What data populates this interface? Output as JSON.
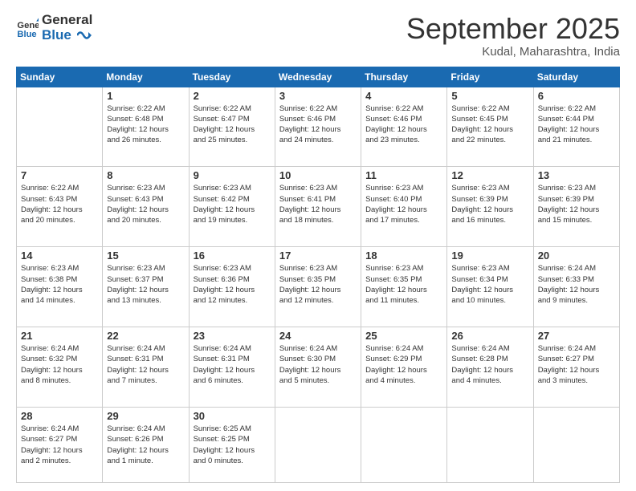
{
  "logo": {
    "line1": "General",
    "line2": "Blue"
  },
  "header": {
    "month": "September 2025",
    "location": "Kudal, Maharashtra, India"
  },
  "days_of_week": [
    "Sunday",
    "Monday",
    "Tuesday",
    "Wednesday",
    "Thursday",
    "Friday",
    "Saturday"
  ],
  "weeks": [
    [
      {
        "num": "",
        "info": ""
      },
      {
        "num": "1",
        "info": "Sunrise: 6:22 AM\nSunset: 6:48 PM\nDaylight: 12 hours\nand 26 minutes."
      },
      {
        "num": "2",
        "info": "Sunrise: 6:22 AM\nSunset: 6:47 PM\nDaylight: 12 hours\nand 25 minutes."
      },
      {
        "num": "3",
        "info": "Sunrise: 6:22 AM\nSunset: 6:46 PM\nDaylight: 12 hours\nand 24 minutes."
      },
      {
        "num": "4",
        "info": "Sunrise: 6:22 AM\nSunset: 6:46 PM\nDaylight: 12 hours\nand 23 minutes."
      },
      {
        "num": "5",
        "info": "Sunrise: 6:22 AM\nSunset: 6:45 PM\nDaylight: 12 hours\nand 22 minutes."
      },
      {
        "num": "6",
        "info": "Sunrise: 6:22 AM\nSunset: 6:44 PM\nDaylight: 12 hours\nand 21 minutes."
      }
    ],
    [
      {
        "num": "7",
        "info": "Sunrise: 6:22 AM\nSunset: 6:43 PM\nDaylight: 12 hours\nand 20 minutes."
      },
      {
        "num": "8",
        "info": "Sunrise: 6:23 AM\nSunset: 6:43 PM\nDaylight: 12 hours\nand 20 minutes."
      },
      {
        "num": "9",
        "info": "Sunrise: 6:23 AM\nSunset: 6:42 PM\nDaylight: 12 hours\nand 19 minutes."
      },
      {
        "num": "10",
        "info": "Sunrise: 6:23 AM\nSunset: 6:41 PM\nDaylight: 12 hours\nand 18 minutes."
      },
      {
        "num": "11",
        "info": "Sunrise: 6:23 AM\nSunset: 6:40 PM\nDaylight: 12 hours\nand 17 minutes."
      },
      {
        "num": "12",
        "info": "Sunrise: 6:23 AM\nSunset: 6:39 PM\nDaylight: 12 hours\nand 16 minutes."
      },
      {
        "num": "13",
        "info": "Sunrise: 6:23 AM\nSunset: 6:39 PM\nDaylight: 12 hours\nand 15 minutes."
      }
    ],
    [
      {
        "num": "14",
        "info": "Sunrise: 6:23 AM\nSunset: 6:38 PM\nDaylight: 12 hours\nand 14 minutes."
      },
      {
        "num": "15",
        "info": "Sunrise: 6:23 AM\nSunset: 6:37 PM\nDaylight: 12 hours\nand 13 minutes."
      },
      {
        "num": "16",
        "info": "Sunrise: 6:23 AM\nSunset: 6:36 PM\nDaylight: 12 hours\nand 12 minutes."
      },
      {
        "num": "17",
        "info": "Sunrise: 6:23 AM\nSunset: 6:35 PM\nDaylight: 12 hours\nand 12 minutes."
      },
      {
        "num": "18",
        "info": "Sunrise: 6:23 AM\nSunset: 6:35 PM\nDaylight: 12 hours\nand 11 minutes."
      },
      {
        "num": "19",
        "info": "Sunrise: 6:23 AM\nSunset: 6:34 PM\nDaylight: 12 hours\nand 10 minutes."
      },
      {
        "num": "20",
        "info": "Sunrise: 6:24 AM\nSunset: 6:33 PM\nDaylight: 12 hours\nand 9 minutes."
      }
    ],
    [
      {
        "num": "21",
        "info": "Sunrise: 6:24 AM\nSunset: 6:32 PM\nDaylight: 12 hours\nand 8 minutes."
      },
      {
        "num": "22",
        "info": "Sunrise: 6:24 AM\nSunset: 6:31 PM\nDaylight: 12 hours\nand 7 minutes."
      },
      {
        "num": "23",
        "info": "Sunrise: 6:24 AM\nSunset: 6:31 PM\nDaylight: 12 hours\nand 6 minutes."
      },
      {
        "num": "24",
        "info": "Sunrise: 6:24 AM\nSunset: 6:30 PM\nDaylight: 12 hours\nand 5 minutes."
      },
      {
        "num": "25",
        "info": "Sunrise: 6:24 AM\nSunset: 6:29 PM\nDaylight: 12 hours\nand 4 minutes."
      },
      {
        "num": "26",
        "info": "Sunrise: 6:24 AM\nSunset: 6:28 PM\nDaylight: 12 hours\nand 4 minutes."
      },
      {
        "num": "27",
        "info": "Sunrise: 6:24 AM\nSunset: 6:27 PM\nDaylight: 12 hours\nand 3 minutes."
      }
    ],
    [
      {
        "num": "28",
        "info": "Sunrise: 6:24 AM\nSunset: 6:27 PM\nDaylight: 12 hours\nand 2 minutes."
      },
      {
        "num": "29",
        "info": "Sunrise: 6:24 AM\nSunset: 6:26 PM\nDaylight: 12 hours\nand 1 minute."
      },
      {
        "num": "30",
        "info": "Sunrise: 6:25 AM\nSunset: 6:25 PM\nDaylight: 12 hours\nand 0 minutes."
      },
      {
        "num": "",
        "info": ""
      },
      {
        "num": "",
        "info": ""
      },
      {
        "num": "",
        "info": ""
      },
      {
        "num": "",
        "info": ""
      }
    ]
  ]
}
